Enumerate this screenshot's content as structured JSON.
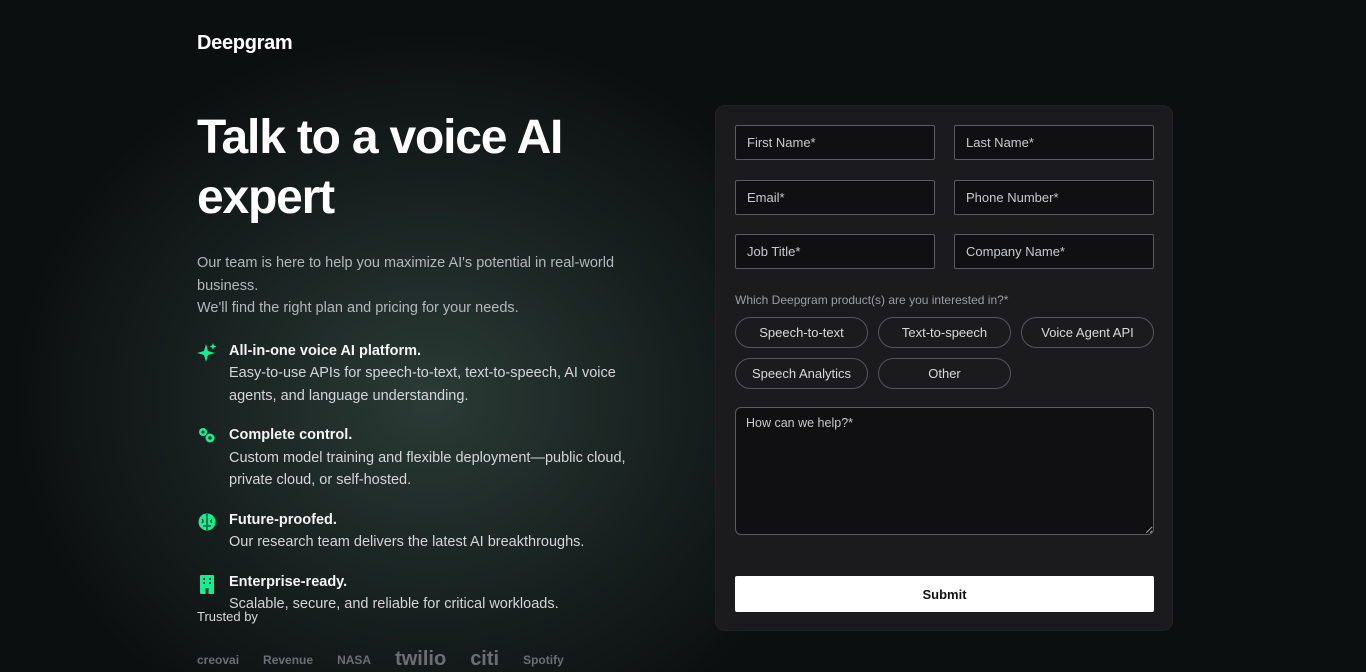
{
  "brand": {
    "logo": "Deepgram"
  },
  "hero": {
    "title": "Talk to a voice AI expert",
    "intro_line1": "Our team is here to help you maximize AI's potential in real-world business.",
    "intro_line2": "We'll find the right plan and pricing for your needs."
  },
  "features": [
    {
      "icon": "sparkle-icon",
      "title": "All-in-one voice AI platform.",
      "body": "Easy-to-use APIs for speech-to-text, text-to-speech, AI voice agents, and language understanding."
    },
    {
      "icon": "gears-icon",
      "title": "Complete control.",
      "body": "Custom model training and flexible deployment—public cloud, private cloud, or self-hosted."
    },
    {
      "icon": "brain-icon",
      "title": "Future-proofed.",
      "body": "Our research team delivers the latest AI breakthroughs."
    },
    {
      "icon": "building-icon",
      "title": "Enterprise-ready.",
      "body": "Scalable, secure, and reliable for critical workloads."
    }
  ],
  "trusted": {
    "label": "Trusted by",
    "logos": [
      "creovai",
      "Revenue",
      "NASA",
      "twilio",
      "citi",
      "Spotify"
    ]
  },
  "form": {
    "first_name": "First Name*",
    "last_name": "Last Name*",
    "email": "Email*",
    "phone": "Phone Number*",
    "job_title": "Job Title*",
    "company": "Company Name*",
    "question": "Which Deepgram product(s) are you interested in?*",
    "products": [
      "Speech-to-text",
      "Text-to-speech",
      "Voice Agent API",
      "Speech Analytics",
      "Other"
    ],
    "message_placeholder": "How can we help?*",
    "submit": "Submit"
  },
  "colors": {
    "accent": "#13ef93",
    "background": "#0b0d0e",
    "card": "#1b1b1e"
  }
}
